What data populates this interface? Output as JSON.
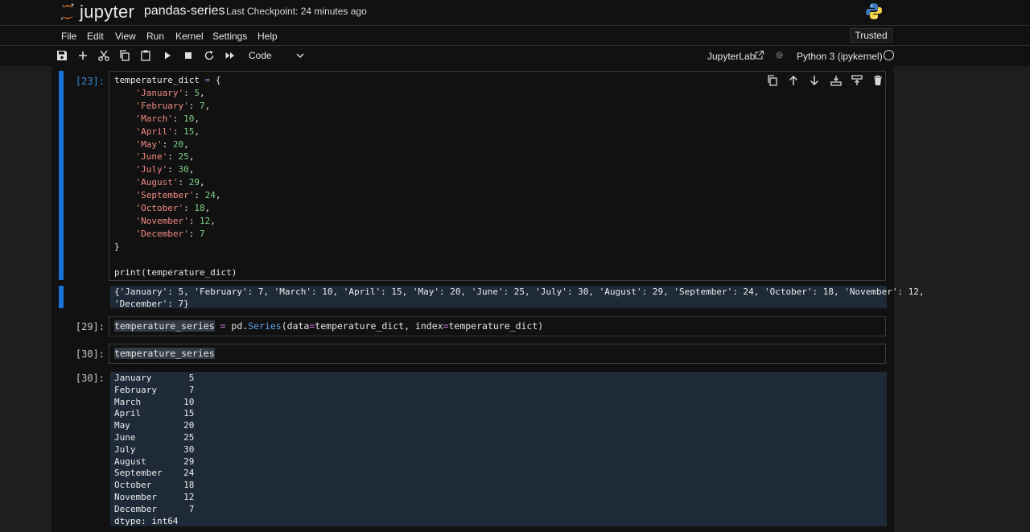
{
  "header": {
    "logo_text": "jupyter",
    "notebook_name": "pandas-series",
    "checkpoint": "Last Checkpoint: 24 minutes ago"
  },
  "menu": {
    "items": [
      "File",
      "Edit",
      "View",
      "Run",
      "Kernel",
      "Settings",
      "Help"
    ],
    "trusted": "Trusted"
  },
  "toolbar": {
    "icons": [
      "save-icon",
      "add-cell-icon",
      "cut-icon",
      "copy-icon",
      "paste-icon",
      "run-icon",
      "stop-icon",
      "restart-icon",
      "run-all-icon"
    ],
    "cell_type": "Code",
    "jupyterlab_label": "JupyterLab",
    "kernel_name": "Python 3 (ipykernel)"
  },
  "cell_toolbar": {
    "icons": [
      "duplicate-icon",
      "move-up-icon",
      "move-down-icon",
      "insert-below-icon",
      "insert-above-icon",
      "delete-icon"
    ]
  },
  "cells": [
    {
      "prompt": "[23]:",
      "code_var": "temperature_dict",
      "code_op": " = ",
      "code_open": "{",
      "code_close": "}",
      "entries": [
        {
          "key": "'January'",
          "value": "5"
        },
        {
          "key": "'February'",
          "value": "7"
        },
        {
          "key": "'March'",
          "value": "10"
        },
        {
          "key": "'April'",
          "value": "15"
        },
        {
          "key": "'May'",
          "value": "20"
        },
        {
          "key": "'June'",
          "value": "25"
        },
        {
          "key": "'July'",
          "value": "30"
        },
        {
          "key": "'August'",
          "value": "29"
        },
        {
          "key": "'September'",
          "value": "24"
        },
        {
          "key": "'October'",
          "value": "18"
        },
        {
          "key": "'November'",
          "value": "12"
        },
        {
          "key": "'December'",
          "value": "7"
        }
      ],
      "print_line": "print(temperature_dict)",
      "output_line1": "{'January': 5, 'February': 7, 'March': 10, 'April': 15, 'May': 20, 'June': 25, 'July': 30, 'August': 29, 'September': 24, 'October': 18, 'November': 12,",
      "output_line2": "'December': 7}"
    },
    {
      "prompt": "[29]:",
      "code_parts": [
        "temperature_series",
        " = ",
        "pd.",
        "Series",
        "(data",
        "=",
        "temperature_dict, index",
        "=",
        "temperature_dict)"
      ]
    },
    {
      "prompt": "[30]:",
      "code": "temperature_series",
      "out_prompt": "[30]:",
      "output_lines": [
        "January       5",
        "February      7",
        "March        10",
        "April        15",
        "May          20",
        "June         25",
        "July         30",
        "August       29",
        "September    24",
        "October      18",
        "November     12",
        "December      7",
        "dtype: int64"
      ]
    }
  ]
}
